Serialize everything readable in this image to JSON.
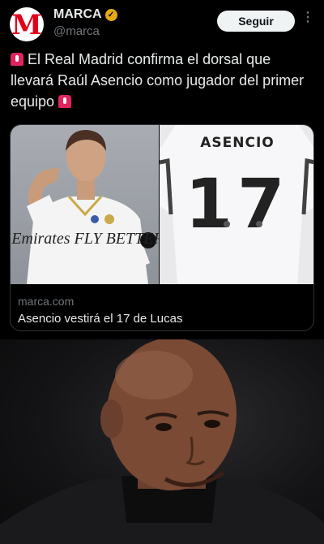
{
  "tweet": {
    "account_name": "MARCA",
    "handle": "@marca",
    "avatar_letter": "M",
    "follow_label": "Seguir",
    "more_label": "⋮",
    "text": "El Real Madrid confirma el dorsal que llevará Raúl Asencio como jugador del primer equipo",
    "colors": {
      "brand": "#e3001b",
      "verified": "#e8a917",
      "background": "#000000"
    }
  },
  "card": {
    "shirt_name": "ASENCIO",
    "shirt_number": "17",
    "jersey_sponsor": "Emirates FLY BETTER",
    "domain": "marca.com",
    "title": "Asencio vestirá el 17 de Lucas"
  },
  "icons": [
    "verified-badge-icon",
    "more-options-icon",
    "siren-icon"
  ]
}
